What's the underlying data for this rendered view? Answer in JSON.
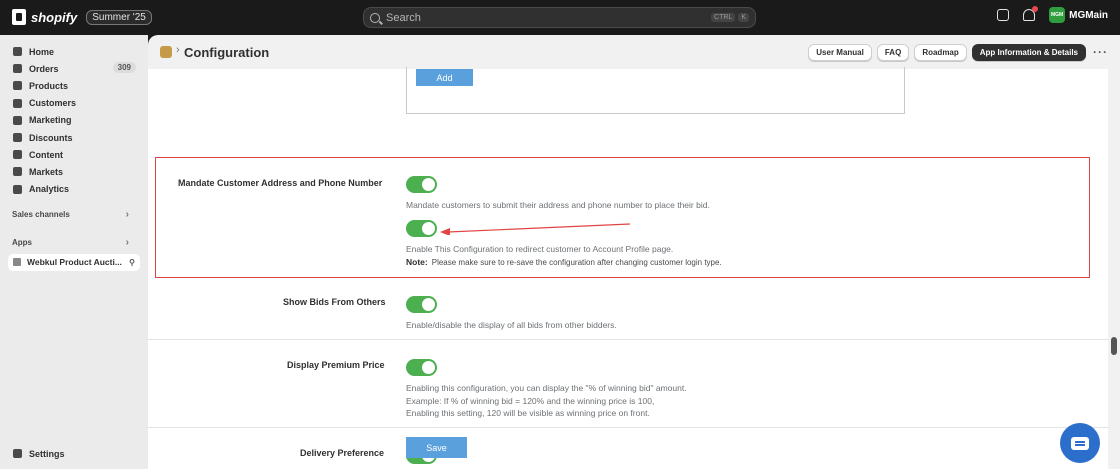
{
  "topbar": {
    "brand": "shopify",
    "edition": "Summer '25",
    "search_placeholder": "Search",
    "kbd_ctrl": "CTRL",
    "kbd_k": "K",
    "store_initials": "MGM",
    "store_name": "MGMain"
  },
  "sidebar": {
    "items": [
      {
        "label": "Home",
        "icon": "home-icon"
      },
      {
        "label": "Orders",
        "icon": "orders-icon",
        "badge": "309"
      },
      {
        "label": "Products",
        "icon": "products-icon"
      },
      {
        "label": "Customers",
        "icon": "customers-icon"
      },
      {
        "label": "Marketing",
        "icon": "marketing-icon"
      },
      {
        "label": "Discounts",
        "icon": "discounts-icon"
      },
      {
        "label": "Content",
        "icon": "content-icon"
      },
      {
        "label": "Markets",
        "icon": "markets-icon"
      },
      {
        "label": "Analytics",
        "icon": "analytics-icon"
      }
    ],
    "sales_channels": "Sales channels",
    "apps": "Apps",
    "app_item": "Webkul Product Aucti...",
    "settings": "Settings"
  },
  "header": {
    "title": "Configuration",
    "buttons": [
      "User Manual",
      "FAQ",
      "Roadmap",
      "App Information & Details"
    ]
  },
  "content": {
    "add_label": "Add",
    "mandate": {
      "label": "Mandate Customer Address and Phone Number",
      "help1": "Mandate customers to submit their address and phone number to place their bid.",
      "help2": "Enable This Configuration to redirect customer to Account Profile page.",
      "note_label": "Note:",
      "note_text": "Please make sure to re-save the configuration after changing customer login type."
    },
    "show_bids": {
      "label": "Show Bids From Others",
      "help": "Enable/disable the display of all bids from other bidders."
    },
    "premium": {
      "label": "Display Premium Price",
      "help1": "Enabling this configuration, you can display the \"% of winning bid\" amount.",
      "help2": "Example: If % of winning bid = 120% and the winning price is 100,",
      "help3": "Enabling this setting, 120 will be visible as winning price on front."
    },
    "delivery": {
      "label": "Delivery Preference"
    },
    "save_label": "Save"
  },
  "colors": {
    "toggle_on": "#4caf50",
    "button_blue": "#5aa0dd",
    "highlight_red": "#e04444",
    "chat_blue": "#2c6ecb"
  }
}
